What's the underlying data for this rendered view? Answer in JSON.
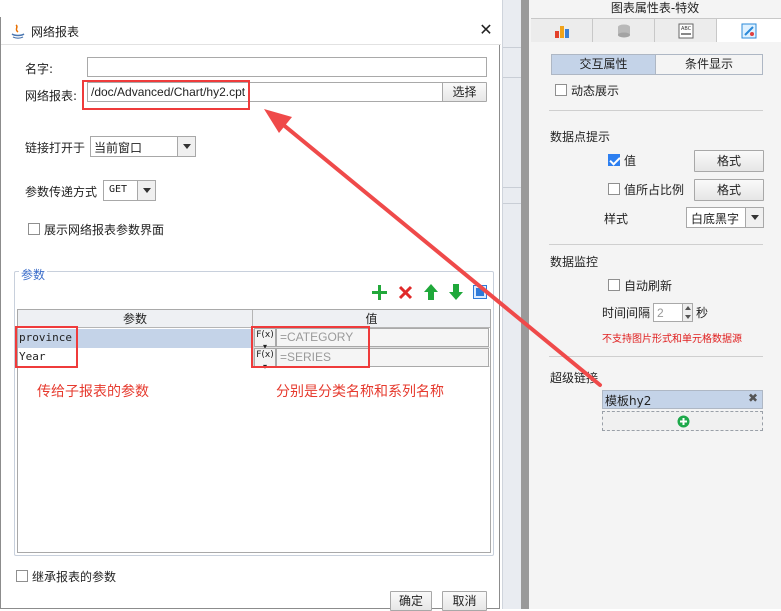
{
  "dialog": {
    "title": "网络报表",
    "name_label": "名字:",
    "name_value": "",
    "report_label": "网络报表:",
    "report_value": "/doc/Advanced/Chart/hy2.cpt",
    "choose_button": "选择",
    "open_in_label": "链接打开于",
    "open_in_value": "当前窗口",
    "param_method_label": "参数传递方式",
    "param_method_value": "GET",
    "show_params_ui_label": "展示网络报表参数界面",
    "params_legend": "参数",
    "table": {
      "headers": [
        "参数",
        "值"
      ],
      "rows": [
        {
          "param": "province",
          "fx": "F(x)",
          "value": "=CATEGORY"
        },
        {
          "param": "Year",
          "fx": "F(x)",
          "value": "=SERIES"
        }
      ]
    },
    "inherit_label": "继承报表的参数",
    "ok_button": "确定",
    "cancel_button": "取消"
  },
  "annotations": {
    "params_note": "传给子报表的参数",
    "values_note": "分别是分类名称和系列名称",
    "color": "#e63a2e"
  },
  "right_panel": {
    "title": "图表属性表-特效",
    "tabs": [
      "chart-type-icon",
      "database-icon",
      "style-icon",
      "effects-icon"
    ],
    "subtabs": [
      "交互属性",
      "条件显示"
    ],
    "dynamic_display_label": "动态展示",
    "datapoint_section": "数据点提示",
    "value_label": "值",
    "value_checked": true,
    "format_button": "格式",
    "ratio_label": "值所占比例",
    "ratio_checked": false,
    "format_button2": "格式",
    "style_label": "样式",
    "style_value": "白底黑字",
    "monitor_section": "数据监控",
    "auto_refresh_label": "自动刷新",
    "interval_label": "时间间隔",
    "interval_value": "2",
    "interval_unit": "秒",
    "warning": "不支持图片形式和单元格数据源",
    "warning_color": "#e02020",
    "hyperlink_section": "超级链接",
    "hyperlink_item": "模板hy2",
    "accent": "#c4d3e8"
  }
}
